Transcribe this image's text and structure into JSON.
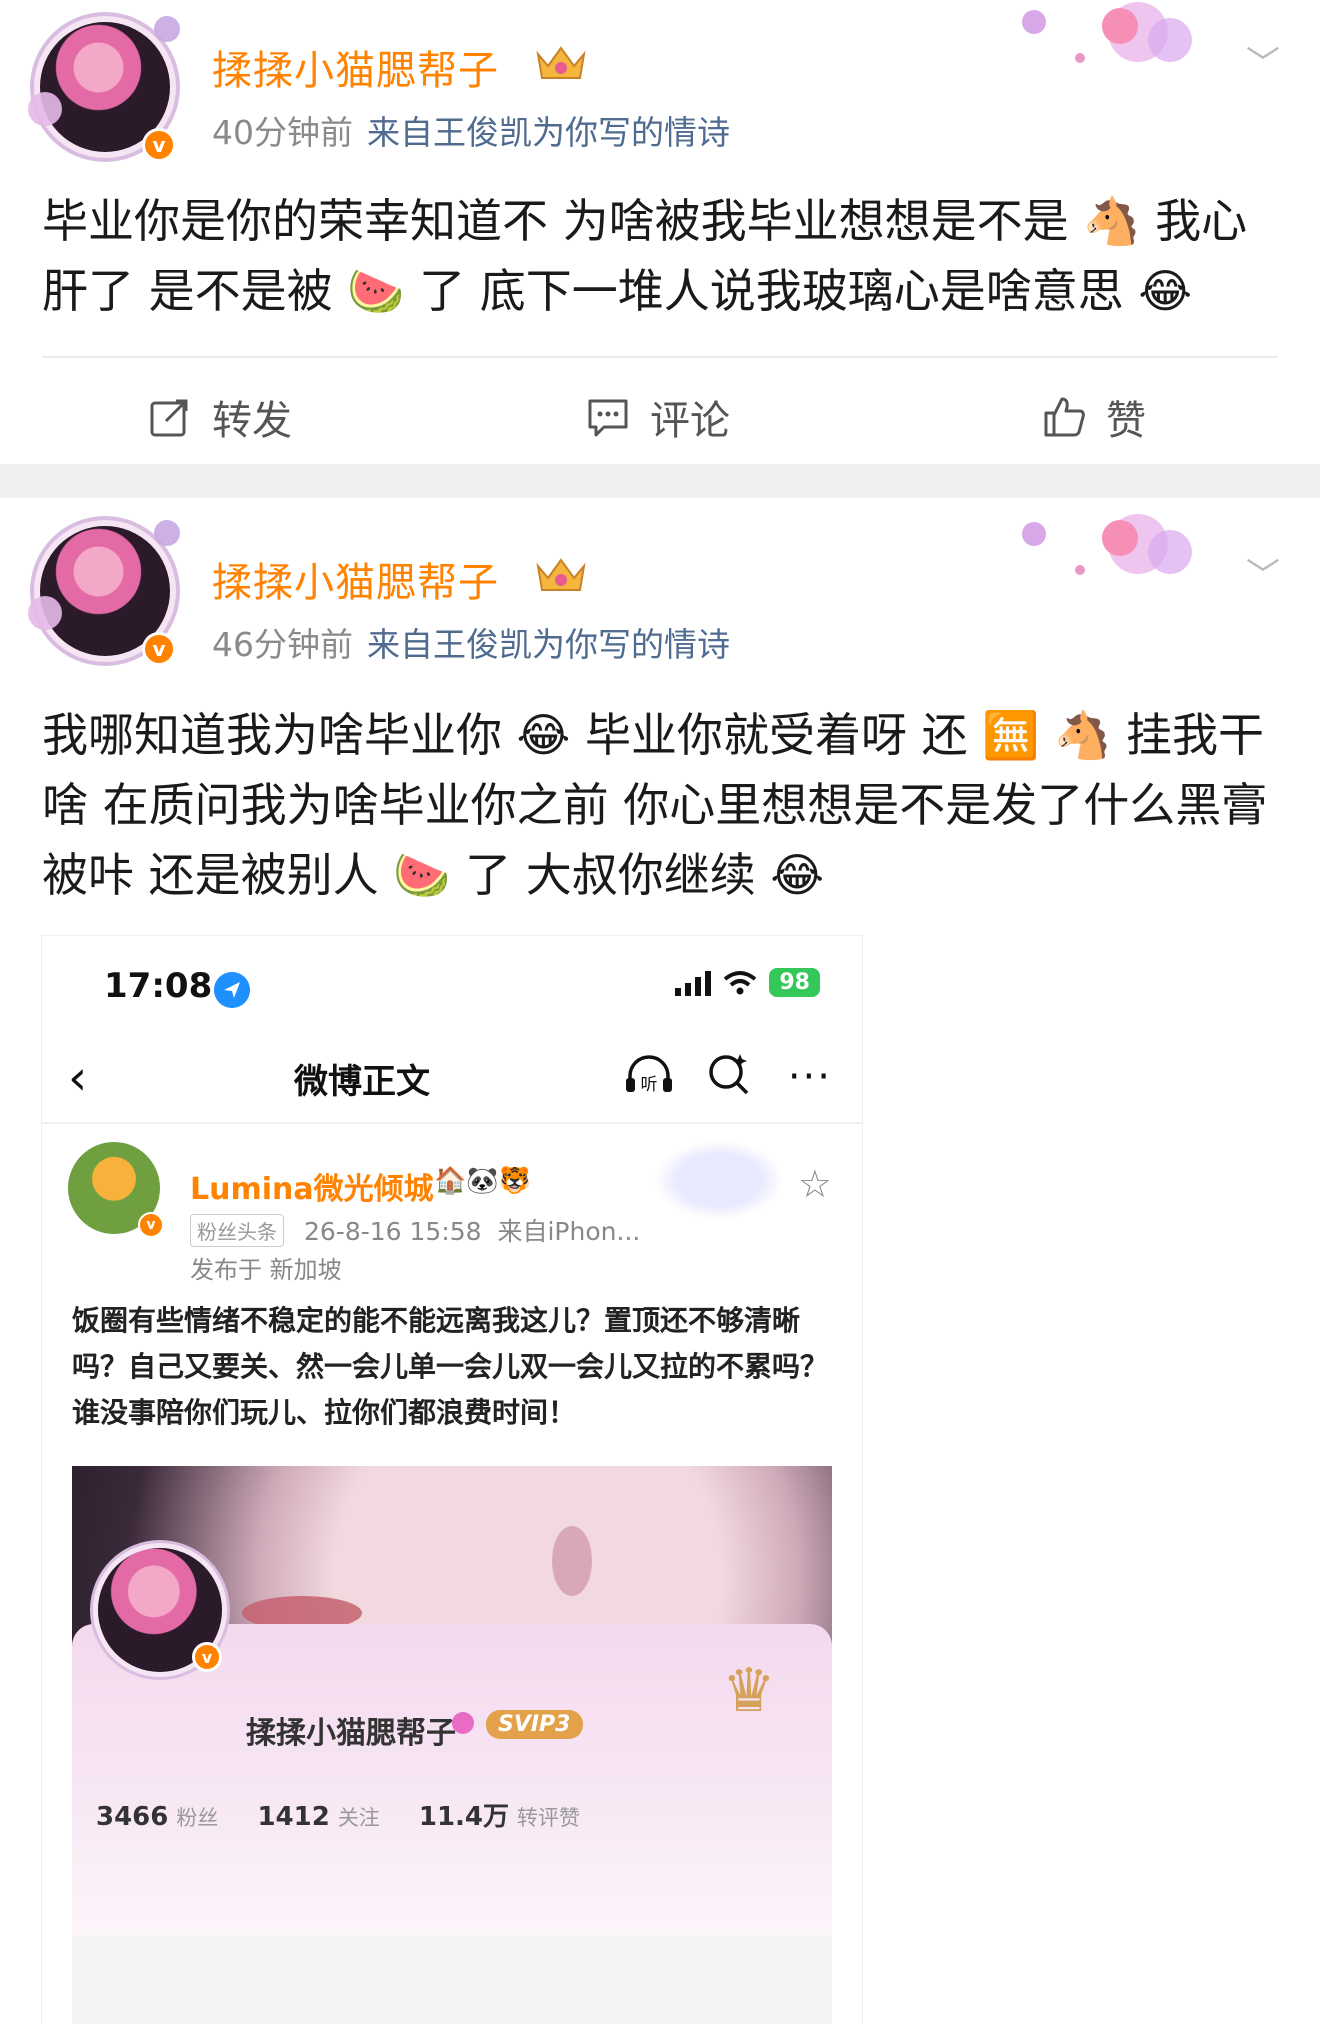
{
  "posts": [
    {
      "username": "揉揉小猫腮帮子",
      "time": "40分钟前",
      "source": "来自王俊凯为你写的情诗",
      "text": "毕业你是你的荣幸知道不 为啥被我毕业想想是不是 🐴 我心肝了 是不是被 🍉 了 底下一堆人说我玻璃心是啥意思 😂",
      "actions": {
        "repost": "转发",
        "comment": "评论",
        "like": "赞"
      }
    },
    {
      "username": "揉揉小猫腮帮子",
      "time": "46分钟前",
      "source": "来自王俊凯为你写的情诗",
      "text": "我哪知道我为啥毕业你 😂 毕业你就受着呀 还 🈚 🐴 挂我干啥 在质问我为啥毕业你之前 你心里想想是不是发了什么黑膏被咔 还是被别人 🍉 了 大叔你继续 😂"
    }
  ],
  "screenshot": {
    "clock": "17:08",
    "battery": "98",
    "nav_title": "微博正文",
    "listen_label": "听",
    "more_label": "···",
    "back_label": "‹",
    "star_label": "☆",
    "post": {
      "username": "Lumina微光倾城",
      "tag": "粉丝头条",
      "date": "26-8-16 15:58",
      "source": "来自iPhon...",
      "location": "发布于 新加坡",
      "text": "饭圈有些情绪不稳定的能不能远离我这儿？置顶还不够清晰吗？自己又要关、然一会儿单一会儿双一会儿又拉的不累吗？谁没事陪你们玩儿、拉你们都浪费时间！"
    },
    "profile": {
      "username": "揉揉小猫腮帮子",
      "badge": "SVIP3",
      "followers_count": "3466",
      "followers_label": "粉丝",
      "following_count": "1412",
      "following_label": "关注",
      "interactions_count": "11.4万",
      "interactions_label": "转评赞"
    }
  },
  "colors": {
    "accent": "#ff8200",
    "source_link": "#4f6b8f",
    "meta_gray": "#8a8a8a"
  }
}
